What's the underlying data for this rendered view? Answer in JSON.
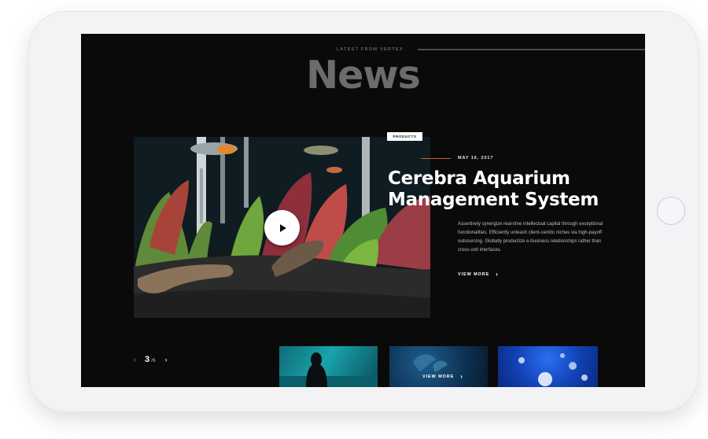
{
  "section": {
    "eyebrow": "LATEST FROM VERTEX",
    "title": "News"
  },
  "featured": {
    "tag": "PRODUCTS",
    "date": "MAY 16, 2017",
    "headline_line1": "Cerebra Aquarium",
    "headline_line2": "Management System",
    "excerpt": "Assertively synergize real-time intellectual capital through exceptional functionalities. Efficiently unleash client-centric niches via high-payoff outsourcing. Globally productize e-business relationships rather than cross-unit interfaces.",
    "view_more": "VIEW MORE",
    "chevron": "›"
  },
  "pager": {
    "prev": "‹",
    "current": "3",
    "separator": "/",
    "total": "6",
    "next": "›"
  },
  "thumbnails": [
    {
      "label": ""
    },
    {
      "label": "VIEW MORE",
      "chevron": "›"
    },
    {
      "label": ""
    }
  ],
  "colors": {
    "screen_bg": "#0a0a0a",
    "accent": "#c8612a",
    "title_grey": "#6c6c6c"
  }
}
